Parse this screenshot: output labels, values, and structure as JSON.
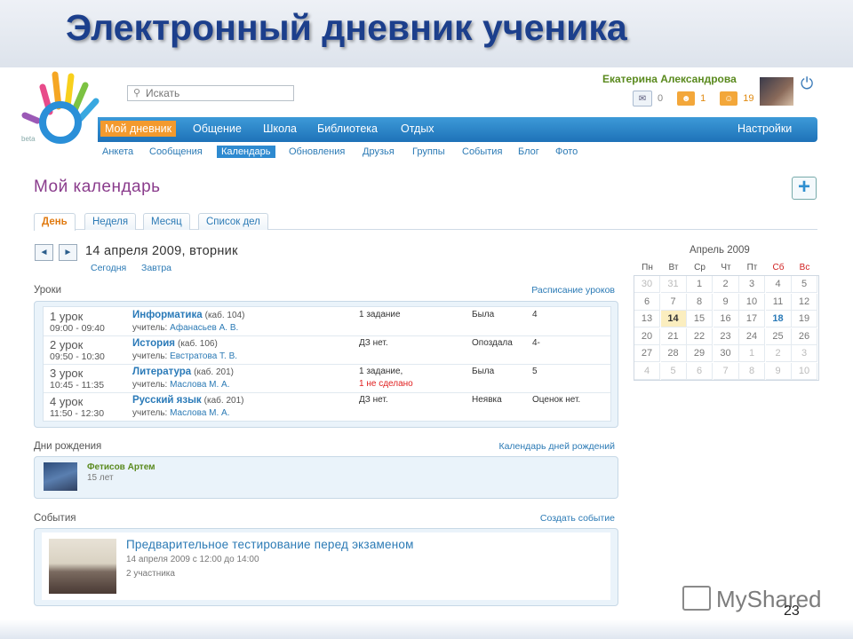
{
  "slide": {
    "title": "Электронный дневник ученика",
    "page_number": "23",
    "watermark": "MyShared"
  },
  "app": {
    "logo_badge": "beta",
    "search": {
      "placeholder": "Искать"
    },
    "user": {
      "name": "Екатерина Александрова"
    },
    "counters": [
      {
        "icon": "mail-icon",
        "value": "0"
      },
      {
        "icon": "friends-icon",
        "value": "1"
      },
      {
        "icon": "groups-icon",
        "value": "19"
      }
    ],
    "main_nav": [
      "Мой дневник",
      "Общение",
      "Школа",
      "Библиотека",
      "Отдых"
    ],
    "main_nav_active": "Мой дневник",
    "settings": "Настройки",
    "sub_nav": [
      "Анкета",
      "Сообщения",
      "Календарь",
      "Обновления",
      "Друзья",
      "Группы",
      "События",
      "Блог",
      "Фото"
    ],
    "sub_nav_active": "Календарь"
  },
  "calendar_page": {
    "title": "Мой календарь",
    "add_button": "+",
    "view_tabs": [
      "День",
      "Неделя",
      "Месяц",
      "Список дел"
    ],
    "view_active": "День",
    "nav": {
      "prev": "◄",
      "next": "►"
    },
    "date_title": "14 апреля 2009, вторник",
    "links": {
      "today": "Сегодня",
      "tomorrow": "Завтра"
    },
    "lessons_label": "Уроки",
    "lessons_link": "Расписание уроков",
    "lessons": [
      {
        "num": "1 урок",
        "time": "09:00 - 09:40",
        "subject": "Информатика",
        "room": "(каб. 104)",
        "teacher_label": "учитель:",
        "teacher": "Афанасьев А. В.",
        "hw": "1 задание",
        "hw_note": "",
        "attendance": "Была",
        "grade": "4"
      },
      {
        "num": "2 урок",
        "time": "09:50 - 10:30",
        "subject": "История",
        "room": "(каб. 106)",
        "teacher_label": "учитель:",
        "teacher": "Евстратова Т. В.",
        "hw": "ДЗ нет.",
        "hw_note": "",
        "attendance": "Опоздала",
        "grade": "4-"
      },
      {
        "num": "3 урок",
        "time": "10:45 - 11:35",
        "subject": "Литература",
        "room": "(каб. 201)",
        "teacher_label": "учитель:",
        "teacher": "Маслова М. А.",
        "hw": "1 задание,",
        "hw_note": "1 не сделано",
        "attendance": "Была",
        "grade": "5"
      },
      {
        "num": "4 урок",
        "time": "11:50 - 12:30",
        "subject": "Русский язык",
        "room": "(каб. 201)",
        "teacher_label": "учитель:",
        "teacher": "Маслова М. А.",
        "hw": "ДЗ нет.",
        "hw_note": "",
        "attendance": "Неявка",
        "grade": "Оценок нет."
      }
    ],
    "birthdays_label": "Дни рождения",
    "birthdays_link": "Календарь дней рождений",
    "birthday": {
      "name": "Фетисов Артем",
      "age": "15 лет"
    },
    "events_label": "События",
    "events_link": "Создать событие",
    "event": {
      "title": "Предварительное тестирование перед экзаменом",
      "date": "14 апреля 2009 с 12:00 до 14:00",
      "participants": "2 участника"
    }
  },
  "mini_calendar": {
    "month": "Апрель 2009",
    "weekdays": [
      "Пн",
      "Вт",
      "Ср",
      "Чт",
      "Пт",
      "Сб",
      "Вс"
    ],
    "weeks": [
      [
        "30",
        "31",
        "1",
        "2",
        "3",
        "4",
        "5"
      ],
      [
        "6",
        "7",
        "8",
        "9",
        "10",
        "11",
        "12"
      ],
      [
        "13",
        "14",
        "15",
        "16",
        "17",
        "18",
        "19"
      ],
      [
        "20",
        "21",
        "22",
        "23",
        "24",
        "25",
        "26"
      ],
      [
        "27",
        "28",
        "29",
        "30",
        "1",
        "2",
        "3"
      ],
      [
        "4",
        "5",
        "6",
        "7",
        "8",
        "9",
        "10"
      ]
    ],
    "today": "14",
    "event_day": "18"
  },
  "colors": {
    "nav_blue": "#1e72b8",
    "active_orange": "#f39a2e",
    "link_blue": "#2b7ab5",
    "heading_purple": "#8a3c8c",
    "user_green": "#5a8a1e"
  }
}
